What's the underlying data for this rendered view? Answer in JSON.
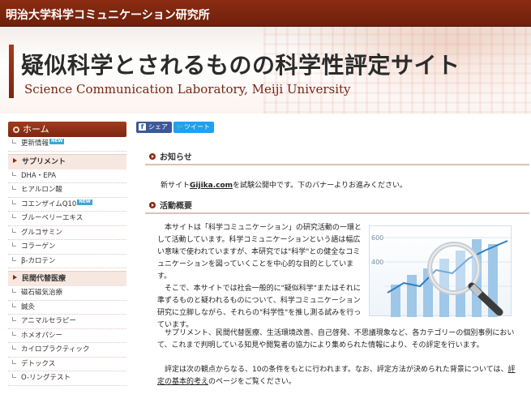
{
  "topbar": {
    "lab_name": "明治大学科学コミュニケーション研究所"
  },
  "header": {
    "title": "疑似科学とされるものの科学性評定サイト",
    "subtitle": "Science Communication Laboratory, Meiji University"
  },
  "sidebar": {
    "home_label": "ホーム",
    "update_item": "更新情報",
    "new_badge": "NEW",
    "categories": [
      {
        "label": "サプリメント",
        "items": [
          {
            "label": "DHA・EPA",
            "new": false
          },
          {
            "label": "ヒアルロン酸",
            "new": false
          },
          {
            "label": "コエンザイムQ10",
            "new": true
          },
          {
            "label": "ブルーベリーエキス",
            "new": false
          },
          {
            "label": "グルコサミン",
            "new": false
          },
          {
            "label": "コラーゲン",
            "new": false
          },
          {
            "label": "β-カロテン",
            "new": false
          }
        ]
      },
      {
        "label": "民間代替医療",
        "items": [
          {
            "label": "磁石磁気治療",
            "new": false
          },
          {
            "label": "鍼灸",
            "new": false
          },
          {
            "label": "アニマルセラピー",
            "new": false
          },
          {
            "label": "ホメオパシー",
            "new": false
          },
          {
            "label": "カイロプラクティック",
            "new": false
          },
          {
            "label": "デトックス",
            "new": false
          },
          {
            "label": "O-リングテスト",
            "new": false
          }
        ]
      }
    ]
  },
  "share": {
    "facebook_label": "シェア",
    "twitter_label": "ツイート"
  },
  "notice": {
    "heading": "お知らせ",
    "text_before": "新サイト",
    "link": "Gijika.com",
    "text_after": "を試験公開中です。下のバナーよりお進みください。"
  },
  "overview": {
    "heading": "活動概要",
    "p1": "本サイトは「科学コミュニケーション」の研究活動の一環として活動しています。科学コミュニケーションという語は幅広い意味で使われていますが、本研究では\"科学\"との健全なコミュニケーションを図っていくことを中心的な目的としています。",
    "p2": "そこで、本サイトでは社会一般的に\"疑似科学\"またはそれに準ずるものと疑われるものについて、科学コミュニケーション研究に立脚しながら、それらの\"科学性\"を推し測る試みを行っています。",
    "p3": "サプリメント、民間代替医療、生活環境改善、自己啓発、不思議現象など、各カテゴリーの個別事例において、これまで判明している知見や閲覧者の協力により集められた情報により、その評定を行います。",
    "p4_before": "評定は次の観点からなる、10の条件をもとに行われます。なお、評定方法が決められた背景については、",
    "p4_link": "評定の基本的考え",
    "p4_after": "のページをご覧ください。"
  },
  "chart_image": {
    "tick_top": "600",
    "tick_mid": "400"
  },
  "colors": {
    "brand": "#7c2812",
    "accent_light": "#f6e7e0",
    "facebook": "#3b5998",
    "twitter": "#1da1f2"
  }
}
